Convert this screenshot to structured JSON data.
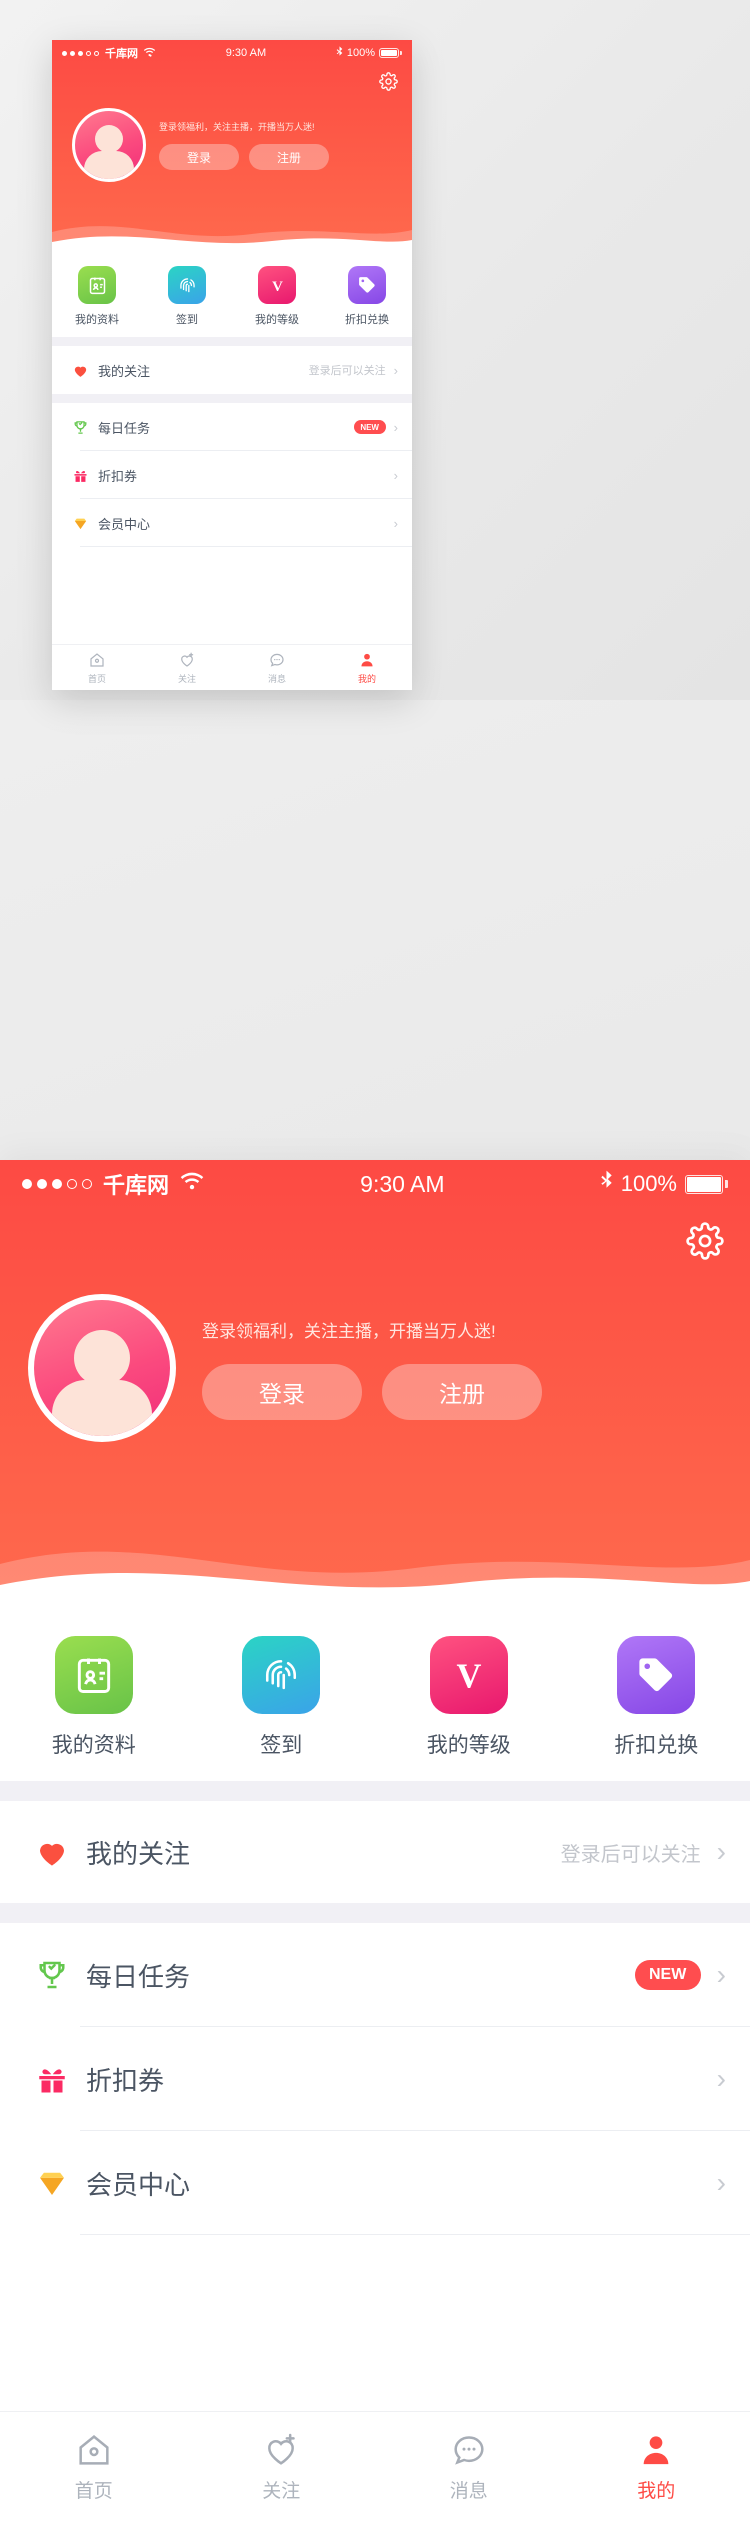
{
  "status_bar": {
    "signal_dots": [
      true,
      true,
      true,
      false,
      false
    ],
    "carrier": "千库网",
    "wifi_icon": "wifi-icon",
    "time": "9:30 AM",
    "bluetooth_icon": "bluetooth-icon",
    "battery_text": "100%"
  },
  "header": {
    "settings_icon": "gear-icon",
    "avatar_icon": "avatar",
    "tagline": "登录领福利，关注主播，开播当万人迷!",
    "login_label": "登录",
    "register_label": "注册",
    "bg_color": "#fd5246"
  },
  "quick_actions": [
    {
      "label": "我的资料",
      "icon": "id-card-icon",
      "color_from": "#9ade4f",
      "color_to": "#6cc64a"
    },
    {
      "label": "签到",
      "icon": "fingerprint-icon",
      "color_from": "#2ad3c5",
      "color_to": "#3ba5e8"
    },
    {
      "label": "我的等级",
      "icon": "vip-v-icon",
      "color_from": "#ff4f7e",
      "color_to": "#e8186e"
    },
    {
      "label": "折扣兑换",
      "icon": "tag-icon",
      "color_from": "#a96cf5",
      "color_to": "#8b4be8"
    }
  ],
  "follow_row": {
    "label": "我的关注",
    "icon": "heart-icon",
    "note": "登录后可以关注",
    "chevron": "chevron-right-icon"
  },
  "menu_rows": [
    {
      "label": "每日任务",
      "icon": "trophy-icon",
      "badge": "NEW",
      "chevron": "chevron-right-icon"
    },
    {
      "label": "折扣券",
      "icon": "gift-icon",
      "badge": "",
      "chevron": "chevron-right-icon"
    },
    {
      "label": "会员中心",
      "icon": "diamond-icon",
      "badge": "",
      "chevron": "chevron-right-icon"
    }
  ],
  "tab_bar": {
    "active_color": "#fe4b45",
    "inactive_color": "#aeb4bd",
    "items": [
      {
        "label": "首页",
        "icon": "home-icon",
        "active": false
      },
      {
        "label": "关注",
        "icon": "heart-plus-icon",
        "active": false
      },
      {
        "label": "消息",
        "icon": "message-icon",
        "active": false
      },
      {
        "label": "我的",
        "icon": "user-icon",
        "active": true
      }
    ]
  }
}
